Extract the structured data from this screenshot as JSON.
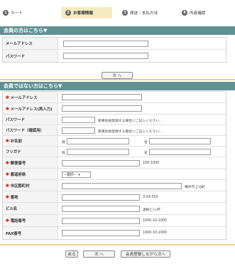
{
  "steps": [
    {
      "num": "1",
      "label": "カート"
    },
    {
      "num": "2",
      "label": "お客様情報"
    },
    {
      "num": "3",
      "label": "発送・支払方法"
    },
    {
      "num": "4",
      "label": "内容確認"
    }
  ],
  "member": {
    "title": "会員の方はこちら▼",
    "email_label": "メールアドレス",
    "email_value": "",
    "password_label": "パスワード",
    "password_value": "",
    "next_label": "次 へ"
  },
  "guest": {
    "title": "会員ではない方はこちら▼",
    "required_mark": "●",
    "email": {
      "label": "メールアドレス",
      "value": ""
    },
    "email_confirm": {
      "label": "メールアドレス(再入力)",
      "value": ""
    },
    "password": {
      "label": "パスワード",
      "note": "新規会員登録する場合にご記入ください。"
    },
    "password_confirm": {
      "label": "パスワード（確認用）",
      "note": "新規会員登録する場合にご記入ください。"
    },
    "name": {
      "label": "お名前",
      "last_prefix": "姓",
      "first_prefix": "名"
    },
    "kana": {
      "label": "フリガナ",
      "last_prefix": "姓",
      "first_prefix": "名"
    },
    "zip": {
      "label": "郵便番号",
      "example": "100-1000"
    },
    "pref": {
      "label": "都道府県",
      "selected": "--選択--"
    },
    "city": {
      "label": "市区郡町村",
      "example": "横浜市上北町"
    },
    "address": {
      "label": "番地",
      "example": "3-24-555"
    },
    "building": {
      "label": "ビル名",
      "example": "透板ビル4F"
    },
    "tel": {
      "label": "電話番号",
      "example": "1000-10-1000"
    },
    "fax": {
      "label": "FAX番号",
      "example": "1000-10-1000"
    }
  },
  "buttons": {
    "back": "戻る",
    "next": "次 へ",
    "register": "会員登録しながら次へ"
  },
  "colors": {
    "section_bar": "#5f9291",
    "active_step": "#f3ebbf",
    "required": "#d23a2a",
    "divider": "#e8d38a"
  }
}
